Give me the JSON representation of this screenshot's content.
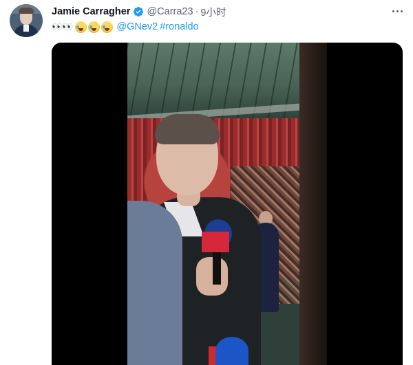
{
  "tweet": {
    "author_name": "Jamie Carragher",
    "handle": "@Carra23",
    "separator": "·",
    "time": "9小时",
    "verified_icon": "verified-badge-icon",
    "more_icon": "more-options-icon",
    "text_prefix": "👀👀",
    "mention": "@GNev2",
    "hashtag": "#ronaldo",
    "emoji_icon": "face-with-tears-of-joy-icon",
    "emoji_count": 3,
    "link_color": "#1d9bf0",
    "name_color": "#0f1419",
    "meta_color": "#536471"
  },
  "media": {
    "type": "video-still",
    "description_icon": "video-thumbnail-icon"
  }
}
